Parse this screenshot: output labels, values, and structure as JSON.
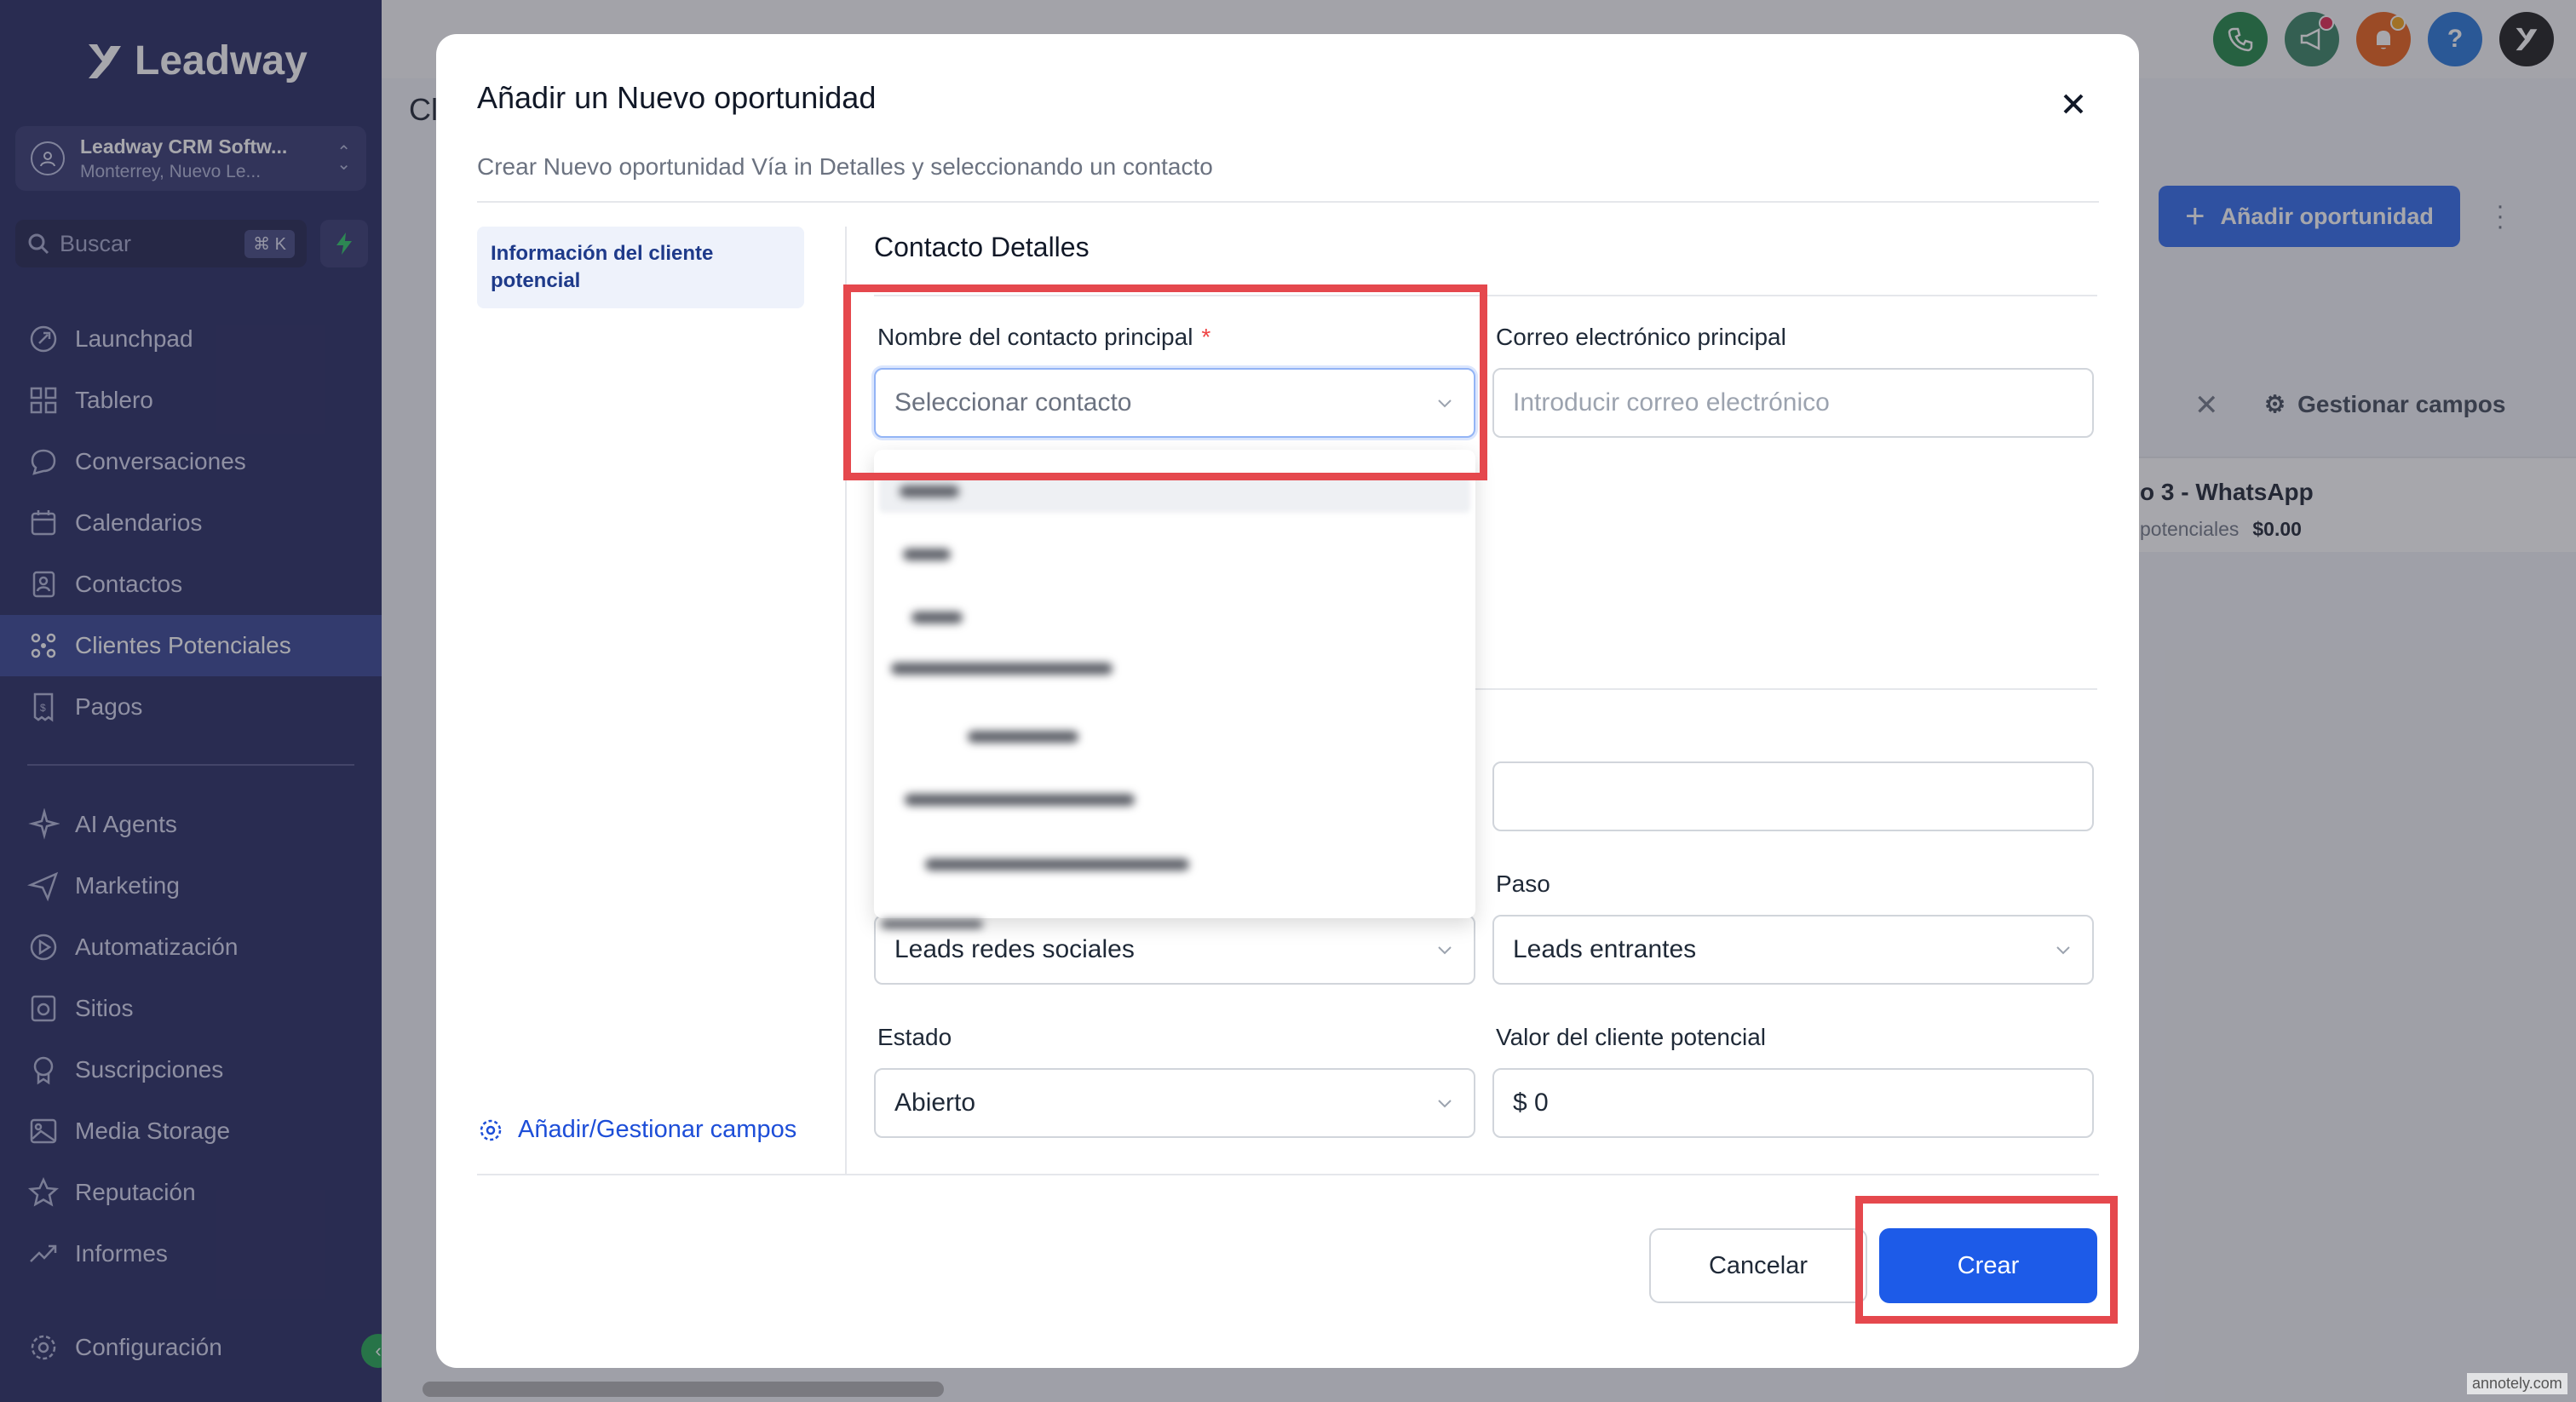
{
  "sidebar": {
    "logo_text": "Leadway",
    "account": {
      "name": "Leadway CRM Softw...",
      "location": "Monterrey, Nuevo Le..."
    },
    "search": {
      "placeholder": "Buscar",
      "shortcut": "⌘ K"
    },
    "items": [
      {
        "label": "Launchpad",
        "icon": "rocket-icon"
      },
      {
        "label": "Tablero",
        "icon": "grid-icon"
      },
      {
        "label": "Conversaciones",
        "icon": "chat-icon"
      },
      {
        "label": "Calendarios",
        "icon": "calendar-icon"
      },
      {
        "label": "Contactos",
        "icon": "contacts-icon"
      },
      {
        "label": "Clientes Potenciales",
        "icon": "funnel-icon",
        "active": true
      },
      {
        "label": "Pagos",
        "icon": "receipt-icon"
      }
    ],
    "items2": [
      {
        "label": "AI Agents",
        "icon": "sparkle-icon"
      },
      {
        "label": "Marketing",
        "icon": "send-icon"
      },
      {
        "label": "Automatización",
        "icon": "play-circle-icon"
      },
      {
        "label": "Sitios",
        "icon": "globe-icon"
      },
      {
        "label": "Suscripciones",
        "icon": "award-icon"
      },
      {
        "label": "Media Storage",
        "icon": "image-icon"
      },
      {
        "label": "Reputación",
        "icon": "star-icon"
      },
      {
        "label": "Informes",
        "icon": "trend-icon"
      }
    ],
    "settings_label": "Configuración"
  },
  "background": {
    "title_fragment": "Cl",
    "add_button": "Añadir oportunidad",
    "manage_fields": "Gestionar campos",
    "card_title": "o 3 - WhatsApp",
    "card_sub": "potenciales",
    "card_value": "$0.00",
    "top_icon_help": "?"
  },
  "modal": {
    "title": "Añadir un Nuevo oportunidad",
    "subtitle": "Crear Nuevo oportunidad Vía in Detalles y seleccionando un contacto",
    "tab_label": "Información del cliente potencial",
    "section_title": "Contacto Detalles",
    "contact_label": "Nombre del contacto principal",
    "required_mark": "*",
    "contact_placeholder": "Seleccionar contacto",
    "email_label": "Correo electrónico principal",
    "email_placeholder": "Introducir correo electrónico",
    "pipeline_value": "Leads redes sociales",
    "stage_label": "Paso",
    "stage_value": "Leads entrantes",
    "status_label": "Estado",
    "status_value": "Abierto",
    "value_label": "Valor del cliente potencial",
    "value_value": "$ 0",
    "manage_link": "Añadir/Gestionar campos",
    "cancel": "Cancelar",
    "create": "Crear"
  },
  "watermark": "annotely.com",
  "colors": {
    "sidebar": "#1b1f5a",
    "primary": "#1d5be8",
    "annotation": "#e5484d"
  }
}
